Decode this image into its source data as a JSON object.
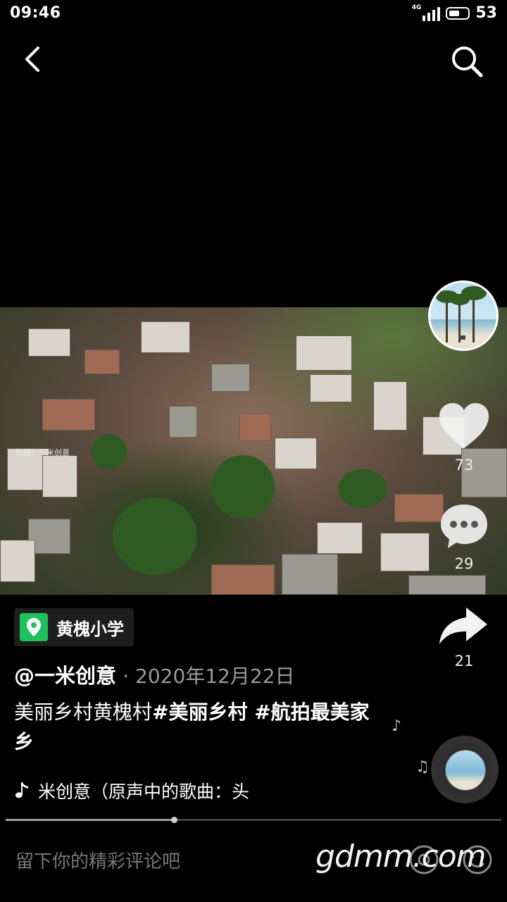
{
  "status_bar": {
    "time": "09:46",
    "network": "4G",
    "battery": "53"
  },
  "video": {
    "credit": "拍摄：一米创意"
  },
  "actions": {
    "likes": "73",
    "comments": "29",
    "shares": "21"
  },
  "location": {
    "label": "黄槐小学"
  },
  "post": {
    "author": "@一米创意",
    "date": "· 2020年12月22日",
    "caption_plain": "美丽乡村黄槐村",
    "caption_tags": "#美丽乡村 #航拍最美家乡"
  },
  "music": {
    "text": "米创意（原声中的歌曲：头"
  },
  "progress": {
    "fraction": 0.34
  },
  "comment_input": {
    "placeholder": "留下你的精彩评论吧"
  },
  "watermark": {
    "text": "gdmm.com"
  },
  "colors": {
    "location_pin": "#20c05c",
    "background": "#000000"
  }
}
